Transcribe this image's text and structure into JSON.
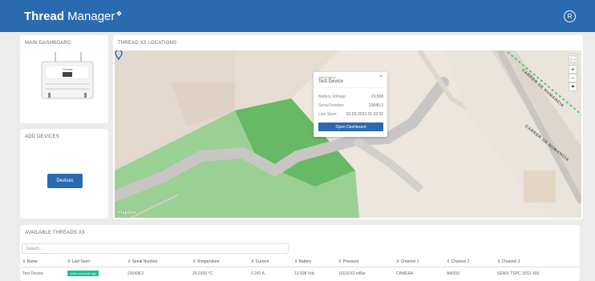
{
  "header": {
    "brand_bold": "Thread",
    "brand_rest": " Manager",
    "avatar": "R"
  },
  "dashboard": {
    "title": "MAIN DASHBOARD",
    "device_brand": "Thread"
  },
  "add_devices": {
    "title": "ADD DEVICES",
    "button": "Devices"
  },
  "map": {
    "title": "THREAD X3 LOCATIONS",
    "streets": [
      "CARRER DE NUMANCIA",
      "CARRER DE NUMANCIA"
    ],
    "attribution": "mapbox",
    "controls": {
      "fullscreen": "⛶",
      "zoom_in": "+",
      "zoom_out": "−",
      "compass": "▲"
    },
    "popup": {
      "label": "Thing Name",
      "name": "Test Device",
      "close": "✕",
      "rows": [
        {
          "label": "Battery Voltage",
          "value": "13.508"
        },
        {
          "label": "Serial Number",
          "value": "23040.3"
        },
        {
          "label": "Last Seen",
          "value": "02-03-2023 21:32:32"
        }
      ],
      "button": "Open Dashboard"
    }
  },
  "threads": {
    "title": "AVAILABLE THREADS X3",
    "search_placeholder": "Search...",
    "columns": [
      "⇕ Name",
      "⇕ Last Seen",
      "⇕ Serial Number",
      "⇕ Temperature",
      "⇕ Current",
      "⇕ Battery",
      "⇕ Pressure",
      "⇕ Channel 1",
      "⇕ Channel 2",
      "⇕ Channel 3"
    ],
    "rows": [
      {
        "name": "Test Device",
        "last_seen": "a few seconds ago",
        "serial": "23043E3",
        "temperature": "26.0100 °C",
        "current": "0.241 A",
        "battery": "13.508 Vdc",
        "pressure": "10110.63 mBar",
        "ch1": "CAMERA",
        "ch2": "AM293",
        "ch3": "SENIX TSPC 30S1 406"
      }
    ]
  }
}
